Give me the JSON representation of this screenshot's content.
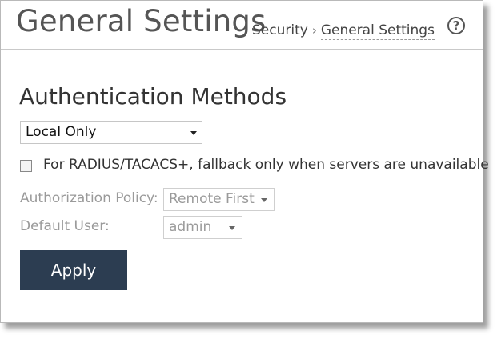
{
  "header": {
    "title": "General Settings",
    "breadcrumb": {
      "parent": "Security",
      "separator": "›",
      "current": "General Settings"
    },
    "help_icon": "?"
  },
  "main": {
    "section_title": "Authentication Methods",
    "auth_method": {
      "value": "Local Only"
    },
    "fallback_checkbox": {
      "label": "For RADIUS/TACACS+, fallback only when servers are unavailable",
      "checked": false
    },
    "authorization_policy": {
      "label": "Authorization Policy:",
      "value": "Remote First",
      "disabled": true
    },
    "default_user": {
      "label": "Default User:",
      "value": "admin",
      "disabled": true
    },
    "apply_label": "Apply"
  },
  "colors": {
    "apply_button_bg": "#2c3d51",
    "title_text": "#555555",
    "disabled_text": "#9a9a9a"
  },
  "icons": [
    "help-icon",
    "chevron-down-icon",
    "breadcrumb-separator-icon"
  ]
}
